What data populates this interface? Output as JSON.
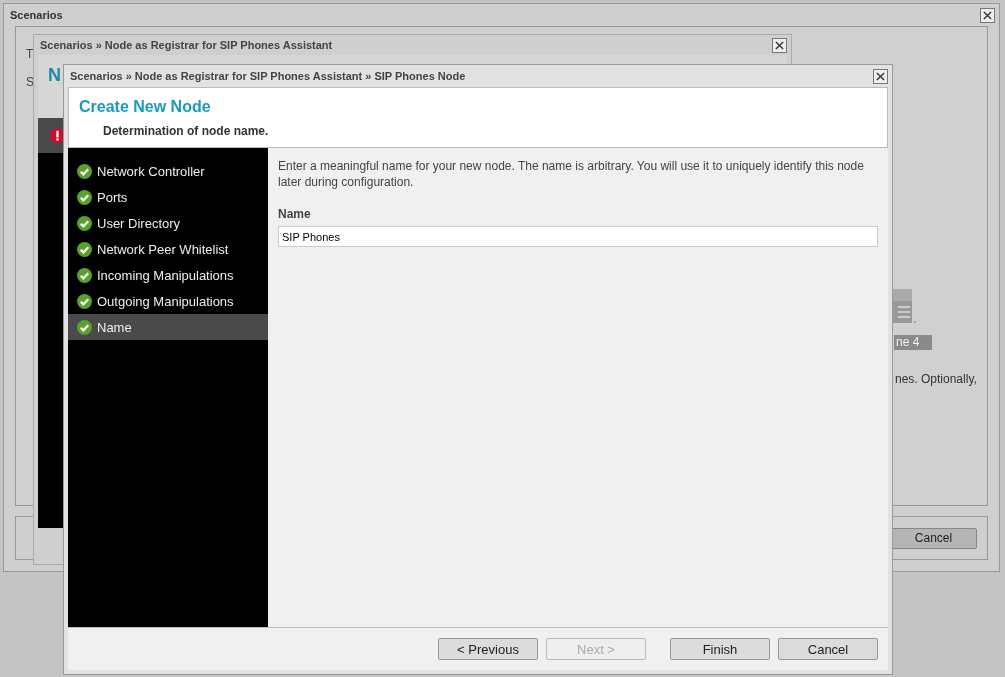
{
  "background_window": {
    "title": "Scenarios",
    "text_fragments": [
      "T",
      "S"
    ],
    "phone_label": "ne 4",
    "description_fragment": "nes. Optionally,",
    "cancel_button": "Cancel"
  },
  "assistant_window": {
    "title": "Scenarios » Node as Registrar for SIP Phones Assistant",
    "heading_fragment": "N"
  },
  "dialog": {
    "title": "Scenarios » Node as Registrar for SIP Phones Assistant » SIP Phones Node",
    "heading": "Create New Node",
    "subheading": "Determination of node name.",
    "steps": [
      {
        "label": "Network Controller",
        "done": true,
        "selected": false
      },
      {
        "label": "Ports",
        "done": true,
        "selected": false
      },
      {
        "label": "User Directory",
        "done": true,
        "selected": false
      },
      {
        "label": "Network Peer Whitelist",
        "done": true,
        "selected": false
      },
      {
        "label": "Incoming Manipulations",
        "done": true,
        "selected": false
      },
      {
        "label": "Outgoing Manipulations",
        "done": true,
        "selected": false
      },
      {
        "label": "Name",
        "done": true,
        "selected": true
      }
    ],
    "intro": "Enter a meaningful name for your new node. The name is arbitrary. You will use it to uniquely identify this node later during configuration.",
    "field": {
      "label": "Name",
      "value": "SIP Phones"
    },
    "buttons": [
      {
        "label": "< Previous",
        "disabled": false
      },
      {
        "label": "Next >",
        "disabled": true
      },
      {
        "label": "Finish",
        "disabled": false
      },
      {
        "label": "Cancel",
        "disabled": false
      }
    ]
  }
}
